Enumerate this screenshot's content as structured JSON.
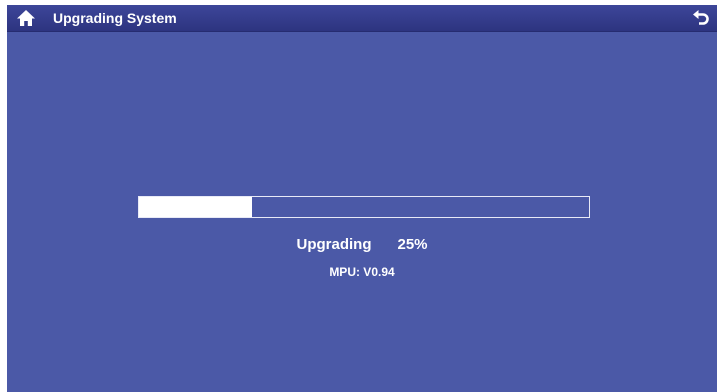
{
  "header": {
    "title": "Upgrading System",
    "home_icon": "home-icon",
    "back_icon": "back-arrow-icon"
  },
  "upgrade": {
    "status_label": "Upgrading",
    "percent_text": "25%",
    "progress_fraction": 0.25,
    "version_text": "MPU: V0.94"
  },
  "colors": {
    "background": "#4b59a7",
    "title_bar": "#2d3480",
    "progress_fill": "#ffffff",
    "text": "#ffffff"
  }
}
